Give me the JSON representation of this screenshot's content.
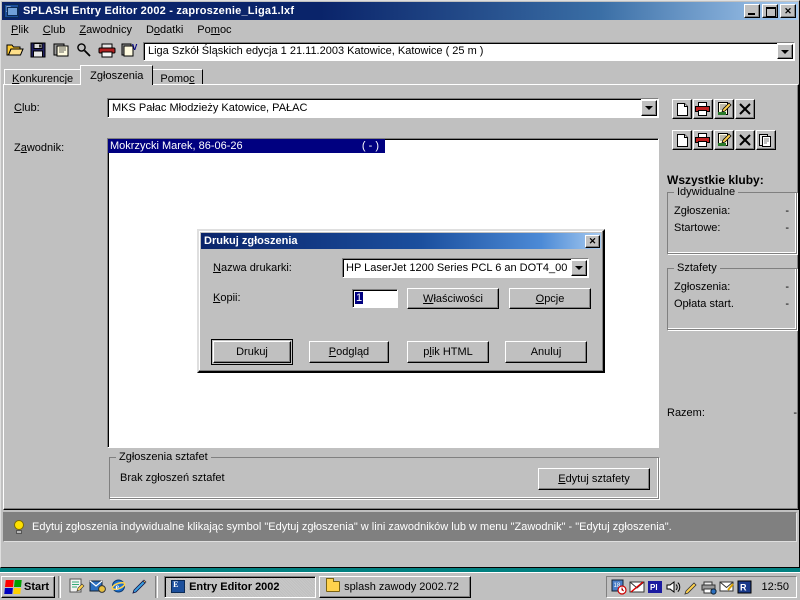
{
  "window": {
    "title": "SPLASH Entry Editor 2002 - zaproszenie_Liga1.lxf",
    "icon": "app-icon",
    "minimize_label": "_",
    "maximize_label": "□",
    "close_label": "✕"
  },
  "menu": [
    {
      "label": "Plik",
      "accel": "P"
    },
    {
      "label": "Club",
      "accel": "C"
    },
    {
      "label": "Zawodnicy",
      "accel": "Z"
    },
    {
      "label": "Dodatki",
      "accel": "o"
    },
    {
      "label": "Pomoc",
      "accel": "m"
    }
  ],
  "toolbar": {
    "icons": [
      {
        "name": "open-folder-icon",
        "glyph": "📂"
      },
      {
        "name": "save-icon",
        "glyph": "💾"
      },
      {
        "name": "properties-icon",
        "glyph": "🗒"
      },
      {
        "name": "find-icon",
        "glyph": "🔍"
      },
      {
        "name": "print-icon",
        "glyph": "🖨"
      },
      {
        "name": "verify-icon",
        "glyph": "✓"
      }
    ],
    "event_combo_value": "Liga Szkół Śląskich edycja 1      21.11.2003 Katowice,  Katowice   ( 25 m )"
  },
  "tabs": [
    {
      "label": "Konkurencje",
      "accel": "K",
      "active": false
    },
    {
      "label": "Zgłoszenia",
      "accel": "g",
      "active": true
    },
    {
      "label": "Pomoc",
      "accel": "c",
      "active": false
    }
  ],
  "form": {
    "club_label": "Club:",
    "club_accel": "C",
    "club_value": "MKS Pałac Młodzieży Katowice,  PAŁAC",
    "athlete_label": "Zawodnik:",
    "athlete_accel": "a",
    "athletes": [
      {
        "name": "Mokrzycki Marek, 86-06-26",
        "flag": "( - )",
        "selected": true
      }
    ]
  },
  "club_buttons": [
    {
      "name": "new-club-icon",
      "glyph": "📄"
    },
    {
      "name": "print-club-icon",
      "glyph": "🖨"
    },
    {
      "name": "edit-club-icon",
      "glyph": "✎"
    },
    {
      "name": "delete-club-icon",
      "glyph": "✕"
    }
  ],
  "athlete_buttons": [
    {
      "name": "new-athlete-icon",
      "glyph": "📄"
    },
    {
      "name": "print-athlete-icon",
      "glyph": "🖨"
    },
    {
      "name": "edit-athlete-icon",
      "glyph": "✎"
    },
    {
      "name": "delete-athlete-icon",
      "glyph": "✕"
    },
    {
      "name": "copy-athlete-icon",
      "glyph": "📑"
    }
  ],
  "summary": {
    "title": "Wszystkie kluby:",
    "individual": {
      "title": "Idywidualne",
      "rows": [
        {
          "label": "Zgłoszenia:",
          "value": "-"
        },
        {
          "label": "Startowe:",
          "value": "-"
        }
      ]
    },
    "relays": {
      "title": "Sztafety",
      "rows": [
        {
          "label": "Zgłoszenia:",
          "value": "-"
        },
        {
          "label": "Opłata start.",
          "value": "-"
        }
      ]
    },
    "total": {
      "label": "Razem:",
      "value": "-"
    }
  },
  "relay_section": {
    "title": "Zgłoszenia sztafet",
    "empty_text": "Brak zgłoszeń sztafet",
    "edit_button": "Edytuj sztafety",
    "edit_button_accel": "E"
  },
  "hint": {
    "icon": "lightbulb-icon",
    "text": "Edytuj zgłoszenia indywidualne klikając symbol \"Edytuj zgłoszenia\" w lini zawodników lub w menu \"Zawodnik\" - \"Edytuj zgłoszenia\"."
  },
  "dialog": {
    "title": "Drukuj zgłoszenia",
    "close_label": "✕",
    "printer_label": "Nazwa drukarki:",
    "printer_accel": "N",
    "printer_value": "HP LaserJet 1200 Series PCL 6 an DOT4_00",
    "copies_label": "Kopii:",
    "copies_accel": "K",
    "copies_value": "1",
    "properties_button": "Właściwości",
    "properties_accel": "W",
    "options_button": "Opcje",
    "options_accel": "O",
    "buttons": [
      {
        "label": "Drukuj",
        "accel": "",
        "default": true
      },
      {
        "label": "Podgląd",
        "accel": "P",
        "default": false
      },
      {
        "label": "plik HTML",
        "accel": "l",
        "default": false
      },
      {
        "label": "Anuluj",
        "accel": "",
        "default": false
      }
    ]
  },
  "taskbar": {
    "start_label": "Start",
    "quicklaunch": [
      {
        "name": "show-desktop-icon"
      },
      {
        "name": "outlook-express-icon"
      },
      {
        "name": "internet-explorer-icon"
      },
      {
        "name": "media-player-icon"
      }
    ],
    "tasks": [
      {
        "label": "Entry Editor 2002",
        "icon": "app-icon",
        "active": true
      },
      {
        "label": "splash zawody 2002.72",
        "icon": "folder-icon",
        "active": false
      }
    ],
    "tray": [
      {
        "name": "scheduler-icon"
      },
      {
        "name": "mail-icon"
      },
      {
        "name": "language-icon",
        "text": "Pl"
      },
      {
        "name": "volume-icon"
      },
      {
        "name": "pencil-icon"
      },
      {
        "name": "printer-monitor-icon"
      },
      {
        "name": "antivirus-icon"
      },
      {
        "name": "network-icon"
      }
    ],
    "clock": "12:50"
  },
  "colors": {
    "desktop": "#008080",
    "face": "#c0c0c0",
    "title_active": "#0a246a",
    "selection": "#000080",
    "hint_bar": "#808080"
  }
}
